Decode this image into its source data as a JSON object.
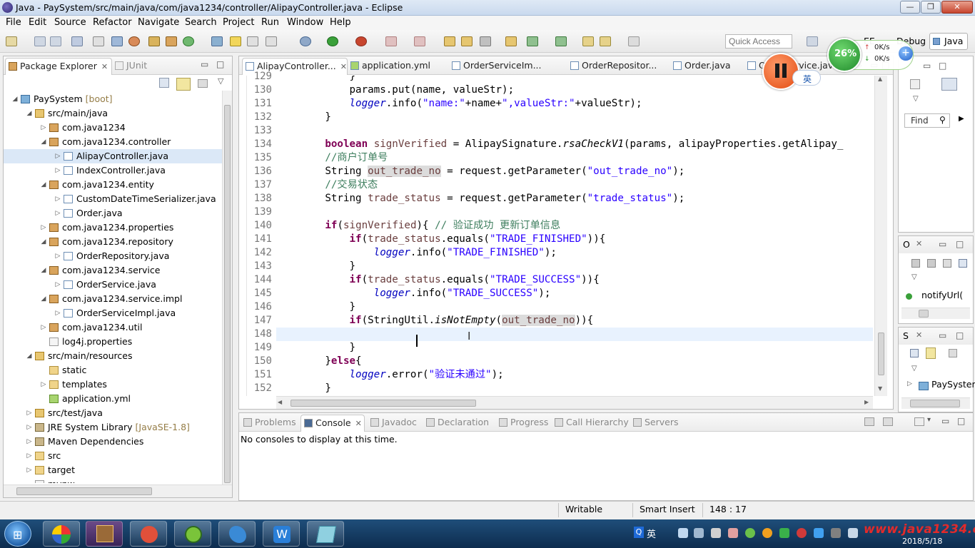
{
  "window": {
    "title": "Java - PaySystem/src/main/java/com/java1234/controller/AlipayController.java - Eclipse",
    "controls": [
      "—",
      "❐",
      "✕"
    ]
  },
  "menu": [
    "File",
    "Edit",
    "Source",
    "Refactor",
    "Navigate",
    "Search",
    "Project",
    "Run",
    "Window",
    "Help"
  ],
  "toolbar": {
    "quick_access_placeholder": "Quick Access",
    "perspectives": [
      "EE",
      "Debug",
      "Java"
    ]
  },
  "overlay": {
    "cpu": "26%",
    "up_speed": "0K/s",
    "down_speed": "0K/s",
    "ime": "英"
  },
  "package_explorer": {
    "tabs": [
      "Package Explorer",
      "JUnit"
    ],
    "tree": [
      {
        "label": "PaySystem",
        "suffix": " [boot]",
        "depth": 0,
        "icon": "proj",
        "twisty": "◢"
      },
      {
        "label": "src/main/java",
        "depth": 1,
        "icon": "src",
        "twisty": "◢"
      },
      {
        "label": "com.java1234",
        "depth": 2,
        "icon": "pkg",
        "twisty": "▷"
      },
      {
        "label": "com.java1234.controller",
        "depth": 2,
        "icon": "pkg",
        "twisty": "◢"
      },
      {
        "label": "AlipayController.java",
        "depth": 3,
        "icon": "java",
        "twisty": "▷",
        "selected": true
      },
      {
        "label": "IndexController.java",
        "depth": 3,
        "icon": "java",
        "twisty": "▷"
      },
      {
        "label": "com.java1234.entity",
        "depth": 2,
        "icon": "pkg",
        "twisty": "◢"
      },
      {
        "label": "CustomDateTimeSerializer.java",
        "depth": 3,
        "icon": "java",
        "twisty": "▷"
      },
      {
        "label": "Order.java",
        "depth": 3,
        "icon": "java",
        "twisty": "▷"
      },
      {
        "label": "com.java1234.properties",
        "depth": 2,
        "icon": "pkg",
        "twisty": "▷"
      },
      {
        "label": "com.java1234.repository",
        "depth": 2,
        "icon": "pkg",
        "twisty": "◢"
      },
      {
        "label": "OrderRepository.java",
        "depth": 3,
        "icon": "java",
        "twisty": "▷"
      },
      {
        "label": "com.java1234.service",
        "depth": 2,
        "icon": "pkg",
        "twisty": "◢"
      },
      {
        "label": "OrderService.java",
        "depth": 3,
        "icon": "java",
        "twisty": "▷"
      },
      {
        "label": "com.java1234.service.impl",
        "depth": 2,
        "icon": "pkg",
        "twisty": "◢"
      },
      {
        "label": "OrderServiceImpl.java",
        "depth": 3,
        "icon": "java",
        "twisty": "▷"
      },
      {
        "label": "com.java1234.util",
        "depth": 2,
        "icon": "pkg",
        "twisty": "▷"
      },
      {
        "label": "log4j.properties",
        "depth": 2,
        "icon": "file",
        "twisty": ""
      },
      {
        "label": "src/main/resources",
        "depth": 1,
        "icon": "src",
        "twisty": "◢"
      },
      {
        "label": "static",
        "depth": 2,
        "icon": "folder",
        "twisty": ""
      },
      {
        "label": "templates",
        "depth": 2,
        "icon": "folder",
        "twisty": "▷"
      },
      {
        "label": "application.yml",
        "depth": 2,
        "icon": "yml",
        "twisty": ""
      },
      {
        "label": "src/test/java",
        "depth": 1,
        "icon": "src",
        "twisty": "▷"
      },
      {
        "label": "JRE System Library",
        "suffix": " [JavaSE-1.8]",
        "depth": 1,
        "icon": "lib",
        "twisty": "▷"
      },
      {
        "label": "Maven Dependencies",
        "depth": 1,
        "icon": "lib",
        "twisty": "▷"
      },
      {
        "label": "src",
        "depth": 1,
        "icon": "folder",
        "twisty": "▷"
      },
      {
        "label": "target",
        "depth": 1,
        "icon": "folder",
        "twisty": "▷"
      },
      {
        "label": "mvnw",
        "depth": 1,
        "icon": "file",
        "twisty": ""
      }
    ]
  },
  "editor": {
    "tabs": [
      {
        "label": "AlipayController...",
        "active": true
      },
      {
        "label": "application.yml"
      },
      {
        "label": "OrderServiceIm..."
      },
      {
        "label": "OrderRepositor..."
      },
      {
        "label": "Order.java"
      },
      {
        "label": "OrderService.java"
      }
    ],
    "lines": [
      {
        "n": "129",
        "tokens": [
          [
            "",
            "            }"
          ]
        ]
      },
      {
        "n": "130",
        "tokens": [
          [
            "",
            "            params.put(name, valueStr);"
          ]
        ]
      },
      {
        "n": "131",
        "tokens": [
          [
            "",
            "            "
          ],
          [
            "fld",
            "logger"
          ],
          [
            "",
            ".info("
          ],
          [
            "str",
            "\"name:\""
          ],
          [
            "",
            "+name+"
          ],
          [
            "str",
            "\",valueStr:\""
          ],
          [
            "",
            "+valueStr);"
          ]
        ]
      },
      {
        "n": "132",
        "tokens": [
          [
            "",
            "        }"
          ]
        ]
      },
      {
        "n": "133",
        "tokens": [
          [
            "",
            ""
          ]
        ]
      },
      {
        "n": "134",
        "tokens": [
          [
            "",
            "        "
          ],
          [
            "kw",
            "boolean"
          ],
          [
            "",
            " "
          ],
          [
            "ovar",
            "signVerified"
          ],
          [
            "",
            " = AlipaySignature."
          ],
          [
            "mth",
            "rsaCheckV1"
          ],
          [
            "",
            "(params, alipayProperties.getAlipay_"
          ]
        ]
      },
      {
        "n": "135",
        "tokens": [
          [
            "",
            "        "
          ],
          [
            "cm",
            "//商户订单号"
          ]
        ]
      },
      {
        "n": "136",
        "tokens": [
          [
            "",
            "        String "
          ],
          [
            "occ",
            "out_trade_no"
          ],
          [
            "",
            " = request.getParameter("
          ],
          [
            "str",
            "\"out_trade_no\""
          ],
          [
            "",
            ");"
          ]
        ]
      },
      {
        "n": "137",
        "tokens": [
          [
            "",
            "        "
          ],
          [
            "cm",
            "//交易状态"
          ]
        ]
      },
      {
        "n": "138",
        "tokens": [
          [
            "",
            "        String "
          ],
          [
            "ovar",
            "trade_status"
          ],
          [
            "",
            " = request.getParameter("
          ],
          [
            "str",
            "\"trade_status\""
          ],
          [
            "",
            ");"
          ]
        ]
      },
      {
        "n": "139",
        "tokens": [
          [
            "",
            ""
          ]
        ]
      },
      {
        "n": "140",
        "tokens": [
          [
            "",
            "        "
          ],
          [
            "kw",
            "if"
          ],
          [
            "",
            "("
          ],
          [
            "ovar",
            "signVerified"
          ],
          [
            "",
            "){ "
          ],
          [
            "cm",
            "// 验证成功 更新订单信息"
          ]
        ]
      },
      {
        "n": "141",
        "tokens": [
          [
            "",
            "            "
          ],
          [
            "kw",
            "if"
          ],
          [
            "",
            "("
          ],
          [
            "ovar",
            "trade_status"
          ],
          [
            "",
            ".equals("
          ],
          [
            "str",
            "\"TRADE_FINISHED\""
          ],
          [
            "",
            ")){"
          ]
        ]
      },
      {
        "n": "142",
        "tokens": [
          [
            "",
            "                "
          ],
          [
            "fld",
            "logger"
          ],
          [
            "",
            ".info("
          ],
          [
            "str",
            "\"TRADE_FINISHED\""
          ],
          [
            "",
            ");"
          ]
        ]
      },
      {
        "n": "143",
        "tokens": [
          [
            "",
            "            }"
          ]
        ]
      },
      {
        "n": "144",
        "tokens": [
          [
            "",
            "            "
          ],
          [
            "kw",
            "if"
          ],
          [
            "",
            "("
          ],
          [
            "ovar",
            "trade_status"
          ],
          [
            "",
            ".equals("
          ],
          [
            "str",
            "\"TRADE_SUCCESS\""
          ],
          [
            "",
            ")){"
          ]
        ]
      },
      {
        "n": "145",
        "tokens": [
          [
            "",
            "                "
          ],
          [
            "fld",
            "logger"
          ],
          [
            "",
            ".info("
          ],
          [
            "str",
            "\"TRADE_SUCCESS\""
          ],
          [
            "",
            ");"
          ]
        ]
      },
      {
        "n": "146",
        "tokens": [
          [
            "",
            "            }"
          ]
        ]
      },
      {
        "n": "147",
        "tokens": [
          [
            "",
            "            "
          ],
          [
            "kw",
            "if"
          ],
          [
            "",
            "(StringUtil."
          ],
          [
            "mth",
            "isNotEmpty"
          ],
          [
            "",
            "("
          ],
          [
            "occ",
            "out_trade_no"
          ],
          [
            "",
            ")){"
          ]
        ]
      },
      {
        "n": "148",
        "tokens": [
          [
            "",
            ""
          ]
        ],
        "current": true
      },
      {
        "n": "149",
        "tokens": [
          [
            "",
            "            }"
          ]
        ]
      },
      {
        "n": "150",
        "tokens": [
          [
            "",
            "        }"
          ],
          [
            "kw",
            "else"
          ],
          [
            "",
            "{"
          ]
        ]
      },
      {
        "n": "151",
        "tokens": [
          [
            "",
            "            "
          ],
          [
            "fld",
            "logger"
          ],
          [
            "",
            ".error("
          ],
          [
            "str",
            "\"验证未通过\""
          ],
          [
            "",
            ");"
          ]
        ]
      },
      {
        "n": "152",
        "tokens": [
          [
            "",
            "        }"
          ]
        ]
      }
    ]
  },
  "right_panels": {
    "find_label": "Find",
    "outline_tab": "O",
    "outline_item": "notifyUrl(",
    "s_tab": "S",
    "s_item": "PaySyster"
  },
  "console": {
    "tabs": [
      "Problems",
      "Console",
      "Javadoc",
      "Declaration",
      "Progress",
      "Call Hierarchy",
      "Servers"
    ],
    "message": "No consoles to display at this time."
  },
  "status": {
    "writable": "Writable",
    "insert_mode": "Smart Insert",
    "position": "148 : 17"
  },
  "taskbar": {
    "watermark": "www.java1234.com",
    "date": "2018/5/18",
    "ime": "英"
  }
}
